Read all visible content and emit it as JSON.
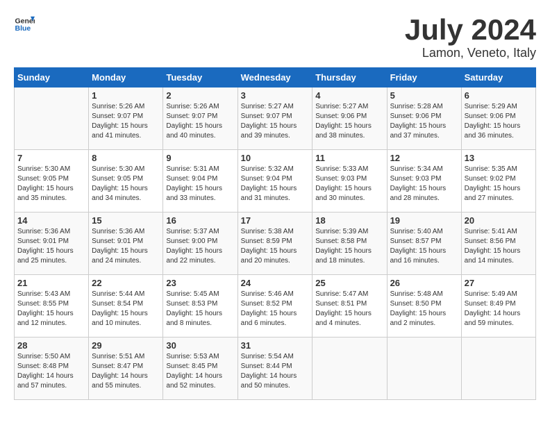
{
  "header": {
    "logo_general": "General",
    "logo_blue": "Blue",
    "month": "July 2024",
    "location": "Lamon, Veneto, Italy"
  },
  "weekdays": [
    "Sunday",
    "Monday",
    "Tuesday",
    "Wednesday",
    "Thursday",
    "Friday",
    "Saturday"
  ],
  "weeks": [
    [
      {
        "day": "",
        "info": ""
      },
      {
        "day": "1",
        "info": "Sunrise: 5:26 AM\nSunset: 9:07 PM\nDaylight: 15 hours\nand 41 minutes."
      },
      {
        "day": "2",
        "info": "Sunrise: 5:26 AM\nSunset: 9:07 PM\nDaylight: 15 hours\nand 40 minutes."
      },
      {
        "day": "3",
        "info": "Sunrise: 5:27 AM\nSunset: 9:07 PM\nDaylight: 15 hours\nand 39 minutes."
      },
      {
        "day": "4",
        "info": "Sunrise: 5:27 AM\nSunset: 9:06 PM\nDaylight: 15 hours\nand 38 minutes."
      },
      {
        "day": "5",
        "info": "Sunrise: 5:28 AM\nSunset: 9:06 PM\nDaylight: 15 hours\nand 37 minutes."
      },
      {
        "day": "6",
        "info": "Sunrise: 5:29 AM\nSunset: 9:06 PM\nDaylight: 15 hours\nand 36 minutes."
      }
    ],
    [
      {
        "day": "7",
        "info": "Sunrise: 5:30 AM\nSunset: 9:05 PM\nDaylight: 15 hours\nand 35 minutes."
      },
      {
        "day": "8",
        "info": "Sunrise: 5:30 AM\nSunset: 9:05 PM\nDaylight: 15 hours\nand 34 minutes."
      },
      {
        "day": "9",
        "info": "Sunrise: 5:31 AM\nSunset: 9:04 PM\nDaylight: 15 hours\nand 33 minutes."
      },
      {
        "day": "10",
        "info": "Sunrise: 5:32 AM\nSunset: 9:04 PM\nDaylight: 15 hours\nand 31 minutes."
      },
      {
        "day": "11",
        "info": "Sunrise: 5:33 AM\nSunset: 9:03 PM\nDaylight: 15 hours\nand 30 minutes."
      },
      {
        "day": "12",
        "info": "Sunrise: 5:34 AM\nSunset: 9:03 PM\nDaylight: 15 hours\nand 28 minutes."
      },
      {
        "day": "13",
        "info": "Sunrise: 5:35 AM\nSunset: 9:02 PM\nDaylight: 15 hours\nand 27 minutes."
      }
    ],
    [
      {
        "day": "14",
        "info": "Sunrise: 5:36 AM\nSunset: 9:01 PM\nDaylight: 15 hours\nand 25 minutes."
      },
      {
        "day": "15",
        "info": "Sunrise: 5:36 AM\nSunset: 9:01 PM\nDaylight: 15 hours\nand 24 minutes."
      },
      {
        "day": "16",
        "info": "Sunrise: 5:37 AM\nSunset: 9:00 PM\nDaylight: 15 hours\nand 22 minutes."
      },
      {
        "day": "17",
        "info": "Sunrise: 5:38 AM\nSunset: 8:59 PM\nDaylight: 15 hours\nand 20 minutes."
      },
      {
        "day": "18",
        "info": "Sunrise: 5:39 AM\nSunset: 8:58 PM\nDaylight: 15 hours\nand 18 minutes."
      },
      {
        "day": "19",
        "info": "Sunrise: 5:40 AM\nSunset: 8:57 PM\nDaylight: 15 hours\nand 16 minutes."
      },
      {
        "day": "20",
        "info": "Sunrise: 5:41 AM\nSunset: 8:56 PM\nDaylight: 15 hours\nand 14 minutes."
      }
    ],
    [
      {
        "day": "21",
        "info": "Sunrise: 5:43 AM\nSunset: 8:55 PM\nDaylight: 15 hours\nand 12 minutes."
      },
      {
        "day": "22",
        "info": "Sunrise: 5:44 AM\nSunset: 8:54 PM\nDaylight: 15 hours\nand 10 minutes."
      },
      {
        "day": "23",
        "info": "Sunrise: 5:45 AM\nSunset: 8:53 PM\nDaylight: 15 hours\nand 8 minutes."
      },
      {
        "day": "24",
        "info": "Sunrise: 5:46 AM\nSunset: 8:52 PM\nDaylight: 15 hours\nand 6 minutes."
      },
      {
        "day": "25",
        "info": "Sunrise: 5:47 AM\nSunset: 8:51 PM\nDaylight: 15 hours\nand 4 minutes."
      },
      {
        "day": "26",
        "info": "Sunrise: 5:48 AM\nSunset: 8:50 PM\nDaylight: 15 hours\nand 2 minutes."
      },
      {
        "day": "27",
        "info": "Sunrise: 5:49 AM\nSunset: 8:49 PM\nDaylight: 14 hours\nand 59 minutes."
      }
    ],
    [
      {
        "day": "28",
        "info": "Sunrise: 5:50 AM\nSunset: 8:48 PM\nDaylight: 14 hours\nand 57 minutes."
      },
      {
        "day": "29",
        "info": "Sunrise: 5:51 AM\nSunset: 8:47 PM\nDaylight: 14 hours\nand 55 minutes."
      },
      {
        "day": "30",
        "info": "Sunrise: 5:53 AM\nSunset: 8:45 PM\nDaylight: 14 hours\nand 52 minutes."
      },
      {
        "day": "31",
        "info": "Sunrise: 5:54 AM\nSunset: 8:44 PM\nDaylight: 14 hours\nand 50 minutes."
      },
      {
        "day": "",
        "info": ""
      },
      {
        "day": "",
        "info": ""
      },
      {
        "day": "",
        "info": ""
      }
    ]
  ]
}
